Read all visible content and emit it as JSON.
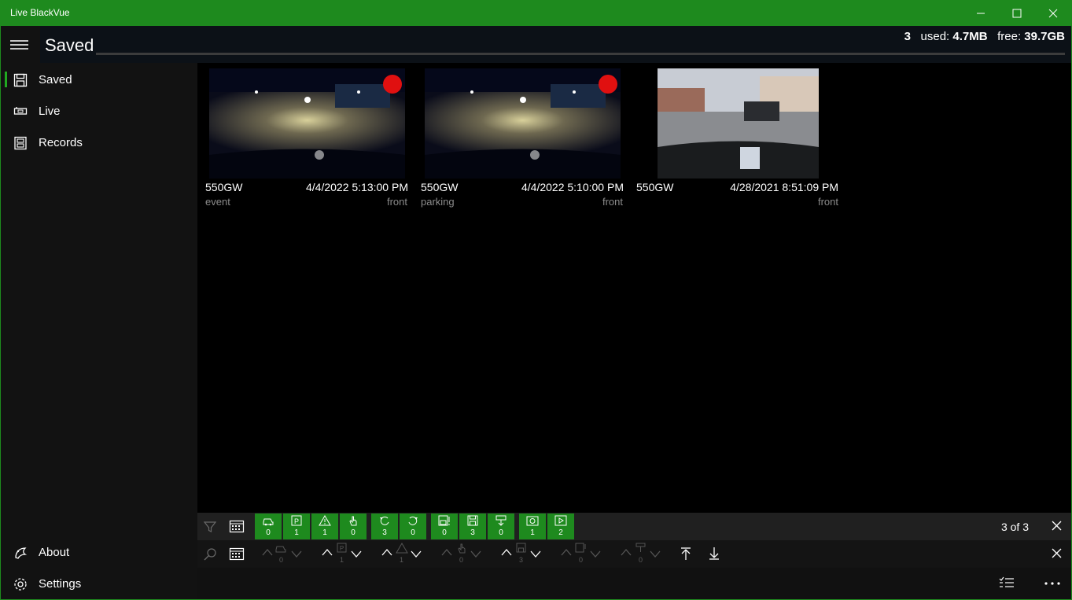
{
  "window": {
    "title": "Live BlackVue"
  },
  "header": {
    "title": "Saved",
    "count": "3",
    "used_label": "used:",
    "used_value": "4.7MB",
    "free_label": "free:",
    "free_value": "39.7GB"
  },
  "sidebar": {
    "items": [
      {
        "label": "Saved",
        "icon": "save-icon"
      },
      {
        "label": "Live",
        "icon": "camera-icon"
      },
      {
        "label": "Records",
        "icon": "records-icon"
      }
    ],
    "bottom": [
      {
        "label": "About",
        "icon": "about-icon"
      },
      {
        "label": "Settings",
        "icon": "gear-icon"
      }
    ]
  },
  "videos": [
    {
      "model": "550GW",
      "datetime": "4/4/2022 5:13:00 PM",
      "type": "event",
      "camera": "front",
      "recording": true
    },
    {
      "model": "550GW",
      "datetime": "4/4/2022 5:10:00 PM",
      "type": "parking",
      "camera": "front",
      "recording": true
    },
    {
      "model": "550GW",
      "datetime": "4/28/2021 8:51:09 PM",
      "type": "",
      "camera": "front",
      "recording": false
    }
  ],
  "filters": [
    {
      "icon": "car-icon",
      "count": "0"
    },
    {
      "icon": "parking-icon",
      "count": "1"
    },
    {
      "icon": "warning-icon",
      "count": "1"
    },
    {
      "icon": "hand-icon",
      "count": "0"
    },
    {
      "icon": "rotate-back-icon",
      "count": "3"
    },
    {
      "icon": "rotate-forward-icon",
      "count": "0"
    },
    {
      "icon": "save-alert-icon",
      "count": "0"
    },
    {
      "icon": "save-icon",
      "count": "3"
    },
    {
      "icon": "download-sign-icon",
      "count": "0"
    },
    {
      "icon": "photo-icon",
      "count": "1"
    },
    {
      "icon": "video-icon",
      "count": "2"
    }
  ],
  "nav_groups": [
    {
      "icon": "car-icon",
      "count": "0"
    },
    {
      "icon": "parking-icon",
      "count": "1"
    },
    {
      "icon": "warning-icon",
      "count": "1"
    },
    {
      "icon": "hand-icon",
      "count": "0"
    },
    {
      "icon": "save-icon",
      "count": "3"
    },
    {
      "icon": "save-alert-icon",
      "count": "0"
    },
    {
      "icon": "download-sign-icon",
      "count": "0"
    }
  ],
  "pagination": {
    "text": "3 of 3"
  },
  "colors": {
    "accent": "#1e8a1e",
    "record_dot": "#e01010"
  }
}
